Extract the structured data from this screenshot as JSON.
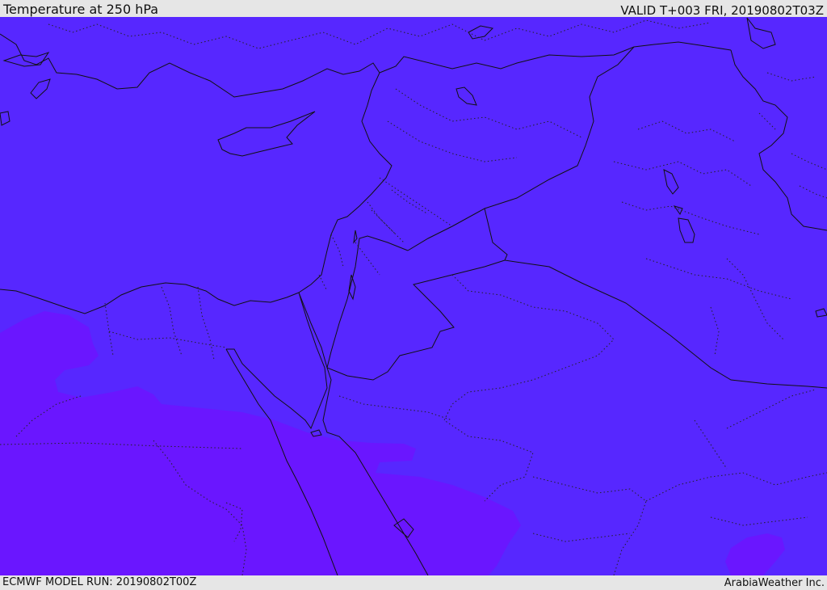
{
  "header": {
    "title": "Temperature at 250 hPa",
    "valid_time": "VALID T+003 FRI, 20190802T03Z"
  },
  "footer": {
    "model_run": "ECMWF MODEL RUN: 20190802T00Z",
    "credit": "ArabiaWeather Inc."
  },
  "map": {
    "background_color": "#5727ff",
    "warm_region_color": "#6a16ff",
    "boundary_color": "#111111"
  }
}
